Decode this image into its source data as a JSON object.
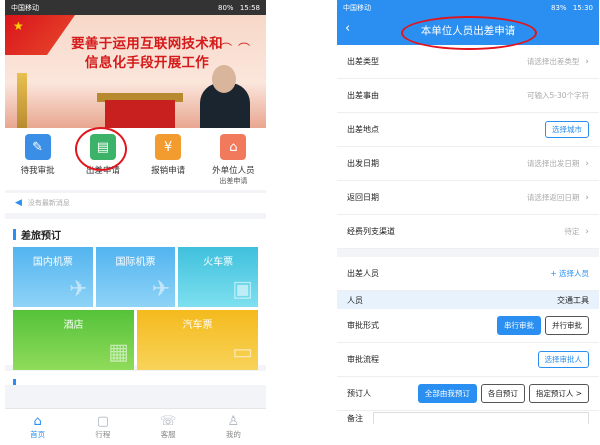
{
  "left": {
    "status": {
      "carrier": "中国移动",
      "battery": "80%",
      "time": "15:58"
    },
    "banner": {
      "title_line1": "要善于运用互联网技术和",
      "title_line2": "信息化手段开展工作"
    },
    "quick_menu": [
      {
        "label": "待我审批",
        "sub": "",
        "icon": "approval-icon",
        "color": "#3a8ee6",
        "glyph": "✎"
      },
      {
        "label": "出差申请",
        "sub": "",
        "icon": "luggage-icon",
        "color": "#3db36a",
        "glyph": "▤"
      },
      {
        "label": "报销申请",
        "sub": "",
        "icon": "reimburse-icon",
        "color": "#f29b2e",
        "glyph": "¥"
      },
      {
        "label": "外单位人员",
        "sub": "出差申请",
        "icon": "external-staff-icon",
        "color": "#f27a5c",
        "glyph": "⌂"
      }
    ],
    "notice": "没有最新消息",
    "travel": {
      "title": "差旅预订",
      "tiles": [
        {
          "label": "国内机票",
          "icon": "plane-icon",
          "glyph": "✈"
        },
        {
          "label": "国际机票",
          "icon": "plane-intl-icon",
          "glyph": "✈"
        },
        {
          "label": "火车票",
          "icon": "train-icon",
          "glyph": "▣"
        },
        {
          "label": "酒店",
          "icon": "hotel-icon",
          "glyph": "▦"
        },
        {
          "label": "汽车票",
          "icon": "bus-icon",
          "glyph": "▭"
        }
      ]
    },
    "tabs": [
      {
        "label": "首页",
        "icon": "home-icon",
        "glyph": "⌂",
        "active": true
      },
      {
        "label": "行程",
        "icon": "trip-icon",
        "glyph": "▢",
        "active": false
      },
      {
        "label": "客服",
        "icon": "phone-icon",
        "glyph": "☏",
        "active": false
      },
      {
        "label": "我的",
        "icon": "user-icon",
        "glyph": "♙",
        "active": false
      }
    ]
  },
  "right": {
    "status": {
      "carrier": "中国移动",
      "battery": "83%",
      "time": "15:30"
    },
    "title": "本单位人员出差申请",
    "rows": [
      {
        "label": "出差类型",
        "value": "请选择出差类型",
        "kind": "chevron"
      },
      {
        "label": "出差事由",
        "value": "可输入5-30个字符",
        "kind": "text"
      },
      {
        "label": "出差地点",
        "value": "选择城市",
        "kind": "button"
      },
      {
        "label": "出发日期",
        "value": "请选择出发日期",
        "kind": "chevron"
      },
      {
        "label": "返回日期",
        "value": "请选择返回日期",
        "kind": "chevron"
      },
      {
        "label": "经费列支渠道",
        "value": "待定",
        "kind": "chevron"
      }
    ],
    "travelers": {
      "label": "出差人员",
      "add": "+ 选择人员"
    },
    "table_head": {
      "col1": "人员",
      "col2": "交通工具"
    },
    "approval_form": {
      "label": "审批形式",
      "options": [
        "串行审批",
        "并行审批"
      ]
    },
    "approval_flow": {
      "label": "审批流程",
      "button": "选择审批人"
    },
    "booker": {
      "label": "预订人",
      "options": [
        "全部由我预订",
        "各自预订",
        "指定预订人 >"
      ]
    },
    "remark_label": "备注"
  }
}
